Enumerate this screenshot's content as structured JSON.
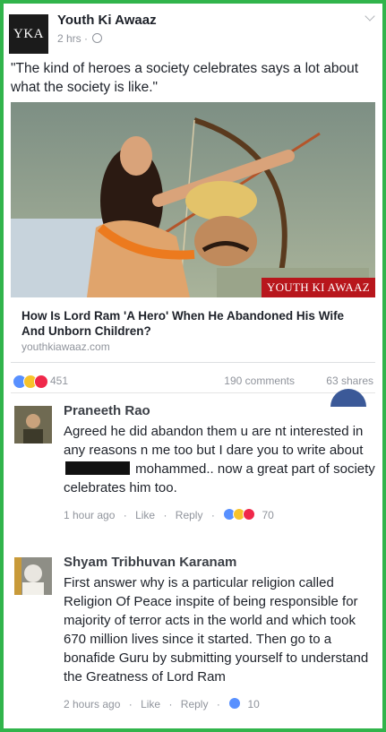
{
  "post": {
    "page_logo_text": "YKA",
    "page_name": "Youth Ki Awaaz",
    "time": "2 hrs ·",
    "text": "\"The kind of heroes a society celebrates says a lot about what the society is like.\"",
    "link": {
      "image_brand": "YOUTH KI AWAAZ",
      "title": "How Is Lord Ram 'A Hero' When He Abandoned His Wife And Unborn Children?",
      "domain": "youthkiawaaz.com"
    },
    "reaction_count": "451",
    "comments_count": "190 comments",
    "shares_count": "63 shares",
    "colors": {
      "like": "#5890ff",
      "haha": "#f7c32b",
      "love": "#f0284a",
      "border": "#31b44b"
    }
  },
  "comments": [
    {
      "author": "Praneeth Rao",
      "text_before": "Agreed he did abandon them u are nt interested in any reasons n me too but I dare you to write about",
      "text_after": "mohammed.. now a great part of society celebrates him too.",
      "time": "1 hour ago",
      "like_label": "Like",
      "reply_label": "Reply",
      "reactions": "70"
    },
    {
      "author": "Shyam Tribhuvan Karanam",
      "text": "First answer why is a particular religion called Religion Of Peace inspite of being responsible for majority of terror acts in the world and which took 670 million lives since it started. Then go to a bonafide Guru by submitting yourself to understand the Greatness of Lord Ram",
      "time": "2 hours ago",
      "like_label": "Like",
      "reply_label": "Reply",
      "reactions": "10"
    }
  ]
}
